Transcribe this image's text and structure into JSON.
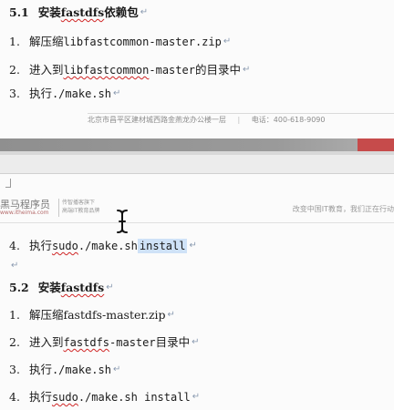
{
  "page_top": {
    "heading": {
      "number": "5.1",
      "text_before": "安装 ",
      "term": "fastdfs",
      "text_after": " 依赖包"
    },
    "steps": [
      {
        "number": "1.",
        "label": "解压缩 ",
        "arg": "libfastcommon-master.zip"
      },
      {
        "number": "2.",
        "label": "进入到 ",
        "arg_underlined": "libfastcommon",
        "arg_rest": "-master",
        "suffix": " 的目录中"
      },
      {
        "number": "3.",
        "label": "执行 ",
        "arg": "./make.sh"
      }
    ],
    "footer": {
      "address": "北京市昌平区建材城西路金燕龙办公楼一层",
      "phone": "电话：400-618-9090"
    }
  },
  "page_bottom": {
    "header": {
      "logo_title": "黑马程序员",
      "logo_sub": "www.itheima.com",
      "logo_desc_1": "传智播客旗下",
      "logo_desc_2": "高端IT教育品牌",
      "slogan": "改变中国IT教育，我们正在行动"
    },
    "step4_top": {
      "number": "4.",
      "label": "执行 ",
      "cmd_underlined": "sudo",
      "cmd_rest": " ./make.sh ",
      "cmd_selected": "install"
    },
    "heading": {
      "number": "5.2",
      "text_before": "安装 ",
      "term": "fastdfs"
    },
    "steps": [
      {
        "number": "1.",
        "label": "解压缩 ",
        "arg": "fastdfs-master.zip"
      },
      {
        "number": "2.",
        "label": "进入到 ",
        "arg_underlined": "fastdfs",
        "arg_rest": "-master",
        "suffix": " 目录中"
      },
      {
        "number": "3.",
        "label": "执行 ",
        "arg": "./make.sh"
      },
      {
        "number": "4.",
        "label": "执行 ",
        "cmd_underlined": "sudo",
        "cmd_rest": " ./make.sh install"
      }
    ]
  },
  "paragraph_mark": "↵",
  "colors": {
    "accent_red": "#c64b4b",
    "spell_underline": "#d02525",
    "selection": "#cfe2f7"
  },
  "icons": {
    "cursor": "text-cursor-icon"
  }
}
